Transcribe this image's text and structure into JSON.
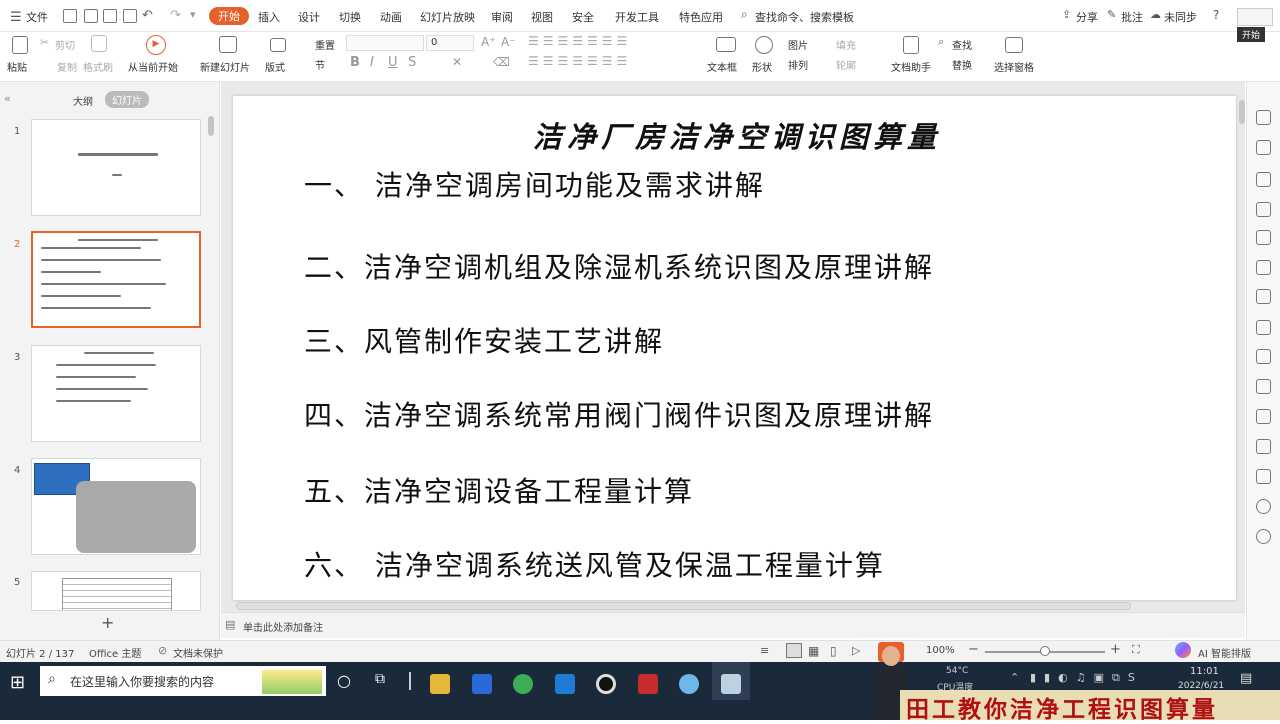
{
  "menubar": {
    "file": "文件",
    "tabs": [
      "开始",
      "插入",
      "设计",
      "切换",
      "动画",
      "幻灯片放映",
      "审阅",
      "视图",
      "安全",
      "开发工具",
      "特色应用"
    ],
    "search": "查找命令、搜索模板",
    "share": "分享",
    "comment": "批注",
    "sync": "未同步",
    "tooltip": "开始"
  },
  "ribbon": {
    "paste": "粘贴",
    "cut": "剪切",
    "copy": "复制",
    "format_painter": "格式刷",
    "from_current": "从当前开始",
    "new_slide": "新建幻灯片",
    "layout": "版式",
    "reset": "重置",
    "section": "节",
    "font_size": "0",
    "textbox": "文本框",
    "shape": "形状",
    "picture": "图片",
    "fill": "填充",
    "arrange": "排列",
    "outline": "轮廓",
    "doc_helper": "文档助手",
    "find": "查找",
    "replace": "替换",
    "selection_pane": "选择窗格"
  },
  "leftpanel": {
    "tab_outline": "大纲",
    "tab_slides": "幻灯片",
    "slide_numbers": [
      "1",
      "2",
      "3",
      "4",
      "5"
    ]
  },
  "slide": {
    "title": "洁净厂房洁净空调识图算量",
    "lines": [
      "一、 洁净空调房间功能及需求讲解",
      "二、洁净空调机组及除湿机系统识图及原理讲解",
      "三、风管制作安装工艺讲解",
      "四、洁净空调系统常用阀门阀件识图及原理讲解",
      "五、洁净空调设备工程量计算",
      "六、 洁净空调系统送风管及保温工程量计算"
    ]
  },
  "notes": {
    "placeholder": "单击此处添加备注"
  },
  "status": {
    "slide_count": "幻灯片 2 / 137",
    "theme": "Office 主题",
    "protect": "文档未保护",
    "zoom": "100%",
    "ai": "AI 智能排版"
  },
  "taskbar": {
    "search_placeholder": "在这里输入你要搜索的内容",
    "temp": "54°C",
    "cpu": "CPU温度",
    "time": "11:01",
    "date": "2022/6/21"
  },
  "overlay": {
    "banner": "田工教你洁净工程识图算量"
  },
  "colors": {
    "accent": "#e8602c",
    "banner_text": "#b01010",
    "banner_bg": "#e9ddb5",
    "taskbar": "#1b2a3a"
  }
}
